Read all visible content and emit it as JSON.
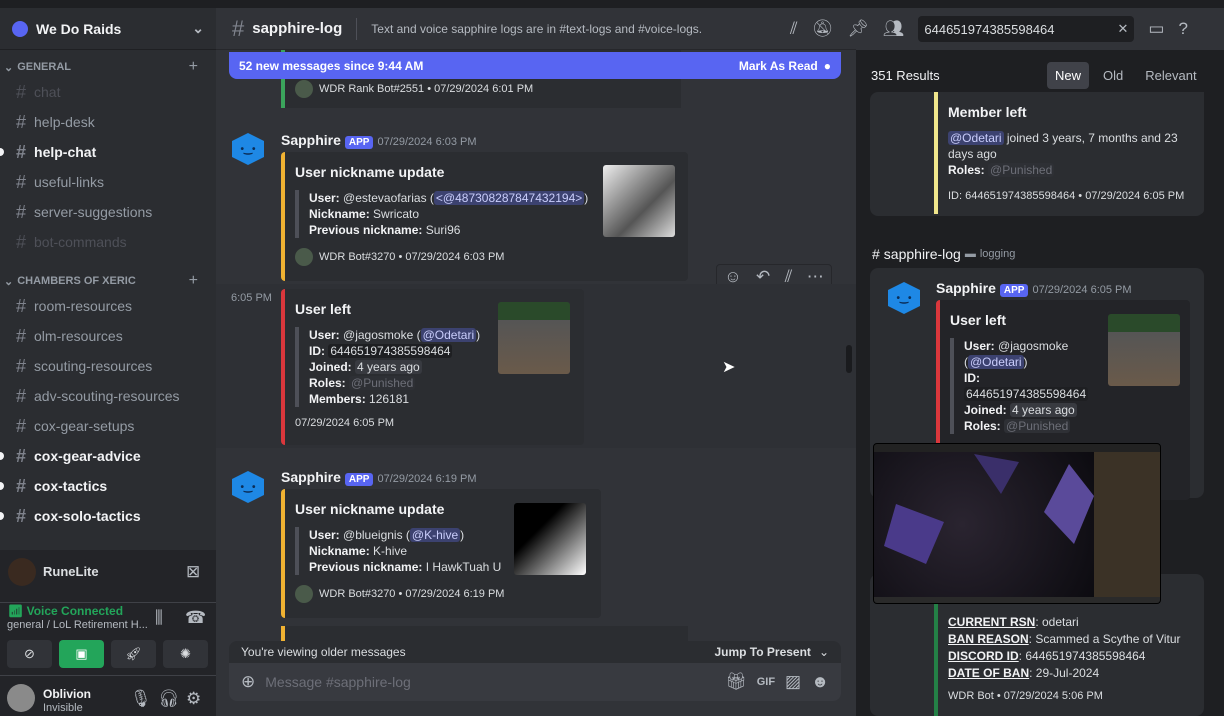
{
  "server": {
    "name": "We Do Raids"
  },
  "categories": [
    {
      "name": "GENERAL",
      "channels": [
        {
          "name": "chat",
          "state": "muted"
        },
        {
          "name": "help-desk",
          "state": "normal"
        },
        {
          "name": "help-chat",
          "state": "unread"
        },
        {
          "name": "useful-links",
          "state": "normal"
        },
        {
          "name": "server-suggestions",
          "state": "normal"
        },
        {
          "name": "bot-commands",
          "state": "muted"
        }
      ]
    },
    {
      "name": "CHAMBERS OF XERIC",
      "channels": [
        {
          "name": "room-resources",
          "state": "normal"
        },
        {
          "name": "olm-resources",
          "state": "normal"
        },
        {
          "name": "scouting-resources",
          "state": "normal"
        },
        {
          "name": "adv-scouting-resources",
          "state": "normal"
        },
        {
          "name": "cox-gear-setups",
          "state": "normal"
        },
        {
          "name": "cox-gear-advice",
          "state": "unread"
        },
        {
          "name": "cox-tactics",
          "state": "unread"
        },
        {
          "name": "cox-solo-tactics",
          "state": "unread"
        }
      ]
    }
  ],
  "stream": {
    "name": "RuneLite"
  },
  "voice": {
    "status": "Voice Connected",
    "channel": "general / LoL Retirement H..."
  },
  "user": {
    "name": "Oblivion",
    "status": "Invisible"
  },
  "channel": {
    "name": "sapphire-log",
    "topic": "Text and voice sapphire logs are in #text-logs and #voice-logs."
  },
  "banner": {
    "text": "52 new messages since 9:44 AM",
    "action": "Mark As Read"
  },
  "search": {
    "value": "644651974385598464",
    "results": "351 Results",
    "sort": [
      "New",
      "Old",
      "Relevant"
    ],
    "active_sort": "New"
  },
  "messages": {
    "prev_footer": "WDR Rank Bot#2551 • 07/29/2024 6:01 PM",
    "m1": {
      "author": "Sapphire",
      "badge": "APP",
      "time": "07/29/2024 6:03 PM",
      "title": "User nickname update",
      "user_l": "User:",
      "user": "@estevaofarias (",
      "mention": "<@487308287847432194>",
      "close": ")",
      "nick_l": "Nickname:",
      "nick": "Swricato",
      "prev_l": "Previous nickname:",
      "prev": "Suri96",
      "footer": "WDR Bot#3270 • 07/29/2024 6:03 PM"
    },
    "m2": {
      "hover_time": "6:05 PM",
      "title": "User left",
      "user_l": "User:",
      "user": "@jagosmoke (",
      "mention": "@Odetari",
      "close": ")",
      "id_l": "ID:",
      "id": "644651974385598464",
      "joined_l": "Joined:",
      "joined": "4 years ago",
      "roles_l": "Roles:",
      "role": "@Punished",
      "members_l": "Members:",
      "members": "126181",
      "footer": "07/29/2024 6:05 PM"
    },
    "m3": {
      "author": "Sapphire",
      "badge": "APP",
      "time": "07/29/2024 6:19 PM",
      "title": "User nickname update",
      "user_l": "User:",
      "user": "@blueignis (",
      "mention": "@K-hive",
      "close": ")",
      "nick_l": "Nickname:",
      "nick": "K-hive",
      "prev_l": "Previous nickname:",
      "prev": "I HawkTuah U",
      "footer": "WDR Bot#3270 • 07/29/2024 6:19 PM"
    }
  },
  "older": {
    "text": "You're viewing older messages",
    "jump": "Jump To Present"
  },
  "composer": {
    "placeholder": "Message #sapphire-log"
  },
  "results": {
    "r1": {
      "title": "Member left",
      "mention": "@Odetari",
      "text": " joined 3 years, 7 months and 23 days ago",
      "roles_l": "Roles:",
      "role": "@Punished",
      "footer": "ID: 644651974385598464 • 07/29/2024 6:05 PM"
    },
    "r2": {
      "channel": "sapphire-log",
      "category": "logging",
      "author": "Sapphire",
      "badge": "APP",
      "time": "07/29/2024 6:05 PM",
      "title": "User left",
      "user_l": "User:",
      "user": "@jagosmoke",
      "mention": "@Odetari",
      "id_l": "ID:",
      "id": "644651974385598464",
      "joined_l": "Joined:",
      "joined": "4 years ago",
      "roles_l": "Roles:",
      "role": "@Punished"
    },
    "r3": {
      "rsn_l": "CURRENT RSN",
      "rsn": ": odetari",
      "reason_l": "BAN REASON",
      "reason": ": Scammed a Scythe of Vitur",
      "did_l": "DISCORD ID",
      "did": ": 644651974385598464",
      "date_l": "DATE OF BAN",
      "date": ": 29-Jul-2024",
      "footer": "WDR Bot • 07/29/2024 5:06 PM"
    }
  },
  "colors": {
    "accent": "#5865f2",
    "voice_green": "#23a55a",
    "embed_yellow": "#f0b232",
    "embed_red": "#da373c",
    "embed_green": "#248046"
  }
}
